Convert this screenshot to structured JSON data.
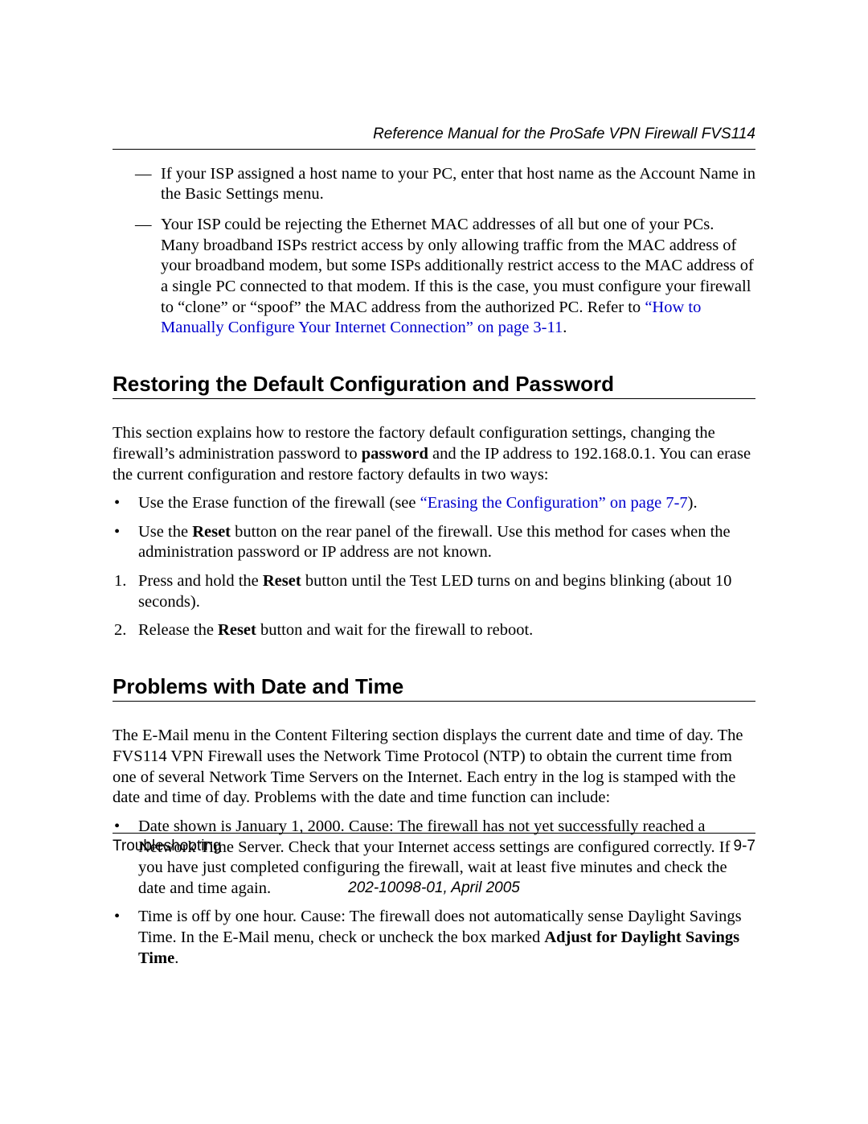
{
  "header": {
    "reference_line": "Reference Manual for the ProSafe VPN Firewall FVS114"
  },
  "continued_list": {
    "items": [
      {
        "text": "If your ISP assigned a host name to your PC, enter that host name as the Account Name in the Basic Settings menu."
      },
      {
        "text_before_link": "Your ISP could be rejecting the Ethernet MAC addresses of all but one of your PCs. Many broadband ISPs restrict access by only allowing traffic from the MAC address of your broadband modem, but some ISPs additionally restrict access to the MAC address of a single PC connected to that modem. If this is the case, you must configure your firewall to “clone” or “spoof” the MAC address from the authorized PC. Refer to ",
        "link": "“How to Manually Configure Your Internet Connection” on page 3-11",
        "text_after_link": "."
      }
    ]
  },
  "section1": {
    "heading": "Restoring the Default Configuration and Password",
    "intro_pre": "This section explains how to restore the factory default configuration settings, changing the firewall’s administration password to ",
    "intro_bold": "password",
    "intro_post": " and the IP address to 192.168.0.1. You can erase the current configuration and restore factory defaults in two ways:",
    "bullets": [
      {
        "pre": "Use the Erase function of the firewall (see ",
        "link": "“Erasing the Configuration” on page 7-7",
        "post": ")."
      },
      {
        "pre": "Use the ",
        "bold": "Reset",
        "post": " button on the rear panel of the firewall. Use this method for cases when the administration password or IP address are not known."
      }
    ],
    "steps": [
      {
        "num": "1.",
        "pre": "Press and hold the ",
        "bold": "Reset",
        "post": " button until the Test LED turns on and begins blinking (about 10 seconds)."
      },
      {
        "num": "2.",
        "pre": "Release the ",
        "bold": "Reset",
        "post": " button and wait for the firewall to reboot."
      }
    ]
  },
  "section2": {
    "heading": "Problems with Date and Time",
    "intro": "The E-Mail menu in the Content Filtering section displays the current date and time of day. The FVS114 VPN Firewall uses the Network Time Protocol (NTP) to obtain the current time from one of several Network Time Servers on the Internet. Each entry in the log is stamped with the date and time of day. Problems with the date and time function can include:",
    "bullets": [
      {
        "text": "Date shown is January 1, 2000. Cause: The firewall has not yet successfully reached a Network Time Server. Check that your Internet access settings are configured correctly. If you have just completed configuring the firewall, wait at least five minutes and check the date and time again."
      },
      {
        "pre": "Time is off by one hour. Cause: The firewall does not automatically sense Daylight Savings Time. In the E-Mail menu, check or uncheck the box marked ",
        "bold": "Adjust for Daylight Savings Time",
        "post": "."
      }
    ]
  },
  "footer": {
    "section_label": "Troubleshooting",
    "page_num": "9-7",
    "doc_id": "202-10098-01, April 2005"
  }
}
